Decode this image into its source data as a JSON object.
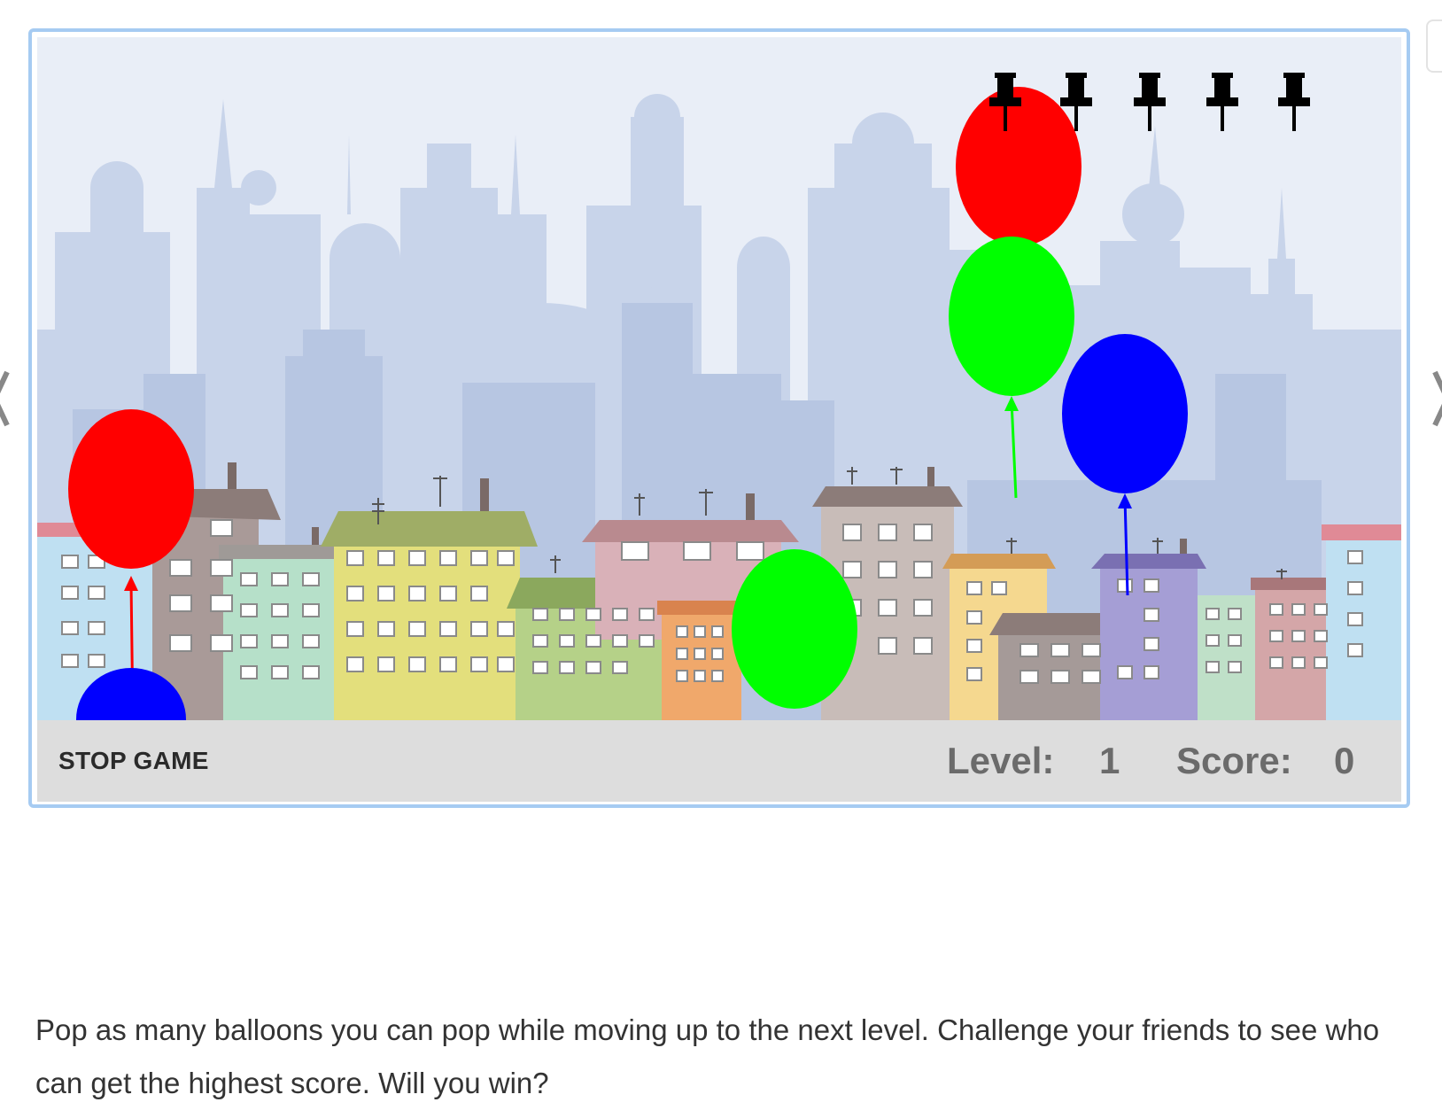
{
  "game": {
    "stop_button_label": "STOP GAME",
    "level_label": "Level:",
    "level_value": "1",
    "score_label": "Score:",
    "score_value": "0",
    "pins_remaining": 5,
    "balloons": [
      {
        "color": "#ff0000"
      },
      {
        "color": "#00ff00"
      },
      {
        "color": "#0000ff"
      },
      {
        "color": "#ff0000"
      },
      {
        "color": "#00ff00"
      },
      {
        "color": "#0000ff"
      }
    ],
    "icons": {
      "pin": "pushpin-icon",
      "nav_left": "chevron-left-icon",
      "nav_right": "chevron-right-icon"
    }
  },
  "description": "Pop as many balloons you can pop while moving up to the next level. Challenge your friends to see who can get the highest score. Will you win?",
  "colors": {
    "frame_border": "#a6cbf2",
    "status_bar": "#dddddd",
    "sky": "#e9eef7",
    "skyline": "#c3cfe6",
    "hud_text": "#6b6b6b"
  }
}
